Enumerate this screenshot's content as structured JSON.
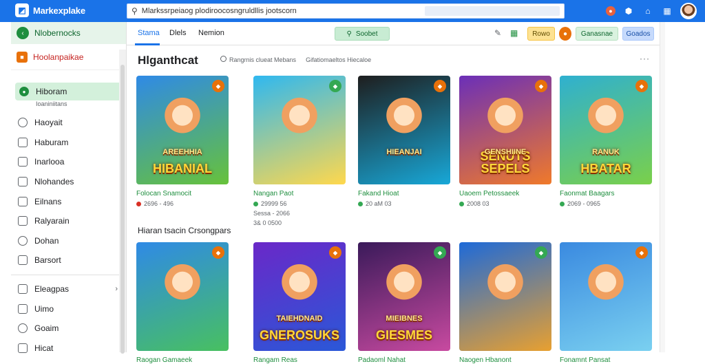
{
  "topbar": {
    "brand_name": "Markexplake",
    "search_value": "Mlarkssrpeiaog plodiroocosngruldllis jootscorn",
    "icons": [
      "notification-icon",
      "shield-icon",
      "home-icon",
      "apps-grid-icon",
      "avatar"
    ]
  },
  "sidebar": {
    "header_label": "Nlobernocks",
    "brand_label": "Hoolanpaikae",
    "active_item": {
      "label": "Hiboram",
      "sub": "Ioaniniitans"
    },
    "items": [
      {
        "label": "Haoyait",
        "icon": "circle-icon"
      },
      {
        "label": "Haburam",
        "icon": "gamepad-icon"
      },
      {
        "label": "Inarlooa",
        "icon": "grid-icon"
      },
      {
        "label": "Nlohandes",
        "icon": "list-icon"
      },
      {
        "label": "Eilnans",
        "icon": "box-icon"
      },
      {
        "label": "Ralyarain",
        "icon": "store-icon"
      },
      {
        "label": "Dohan",
        "icon": "circle-icon"
      },
      {
        "label": "Barsort",
        "icon": "square-icon"
      }
    ],
    "bottom_items": [
      {
        "label": "Eleagpas",
        "icon": "folder-icon"
      },
      {
        "label": "Uimo",
        "icon": "chart-icon"
      },
      {
        "label": "Goaim",
        "icon": "clock-icon"
      },
      {
        "label": "Hicat",
        "icon": "doc-icon"
      }
    ]
  },
  "toolbar": {
    "tabs": [
      "Stama",
      "Dlels",
      "Nemion"
    ],
    "active_tab": "Stama",
    "green_button": "Soobet",
    "yellow_button": "Rowo",
    "light_green_button": "Ganasnae",
    "blue_button": "Goados"
  },
  "content": {
    "heading": "Hlganthcat",
    "meta_one": "Rangrnis clueat Mebans",
    "meta_two": "Gifatiomaeltos Hiecaloe",
    "more": "···",
    "section_title": "Hiaran tsacin Crsongpars"
  },
  "cards_row1": [
    {
      "title": "Folocan Snamocit",
      "meta": "2696 - 496",
      "art": "HIBANIAL",
      "art_sub": "AREEHHIA",
      "badge_color": "#e8710a",
      "meta_dot": "#d93025",
      "bg1": "#2f8ae6",
      "bg2": "#67c23a"
    },
    {
      "title": "Nangan Paot",
      "meta": "29999 56",
      "meta2": "Sessa - 2066",
      "meta2_b": "3& 0 0500",
      "art": "",
      "badge_color": "#34a853",
      "meta_dot": "#34a853",
      "bg1": "#2fb8f0",
      "bg2": "#ffd84d"
    },
    {
      "title": "Fakand Hioat",
      "meta": "20 aM 03",
      "art": "",
      "art_sub": "HIEANJAI",
      "badge_color": "#e8710a",
      "meta_dot": "#34a853",
      "bg1": "#1e1e1e",
      "bg2": "#18a8d8"
    },
    {
      "title": "Uaoem Petossaeek",
      "meta": "2008 03",
      "art": "SENUTS SEPELS",
      "art_sub": "GENSHIINE",
      "badge_color": "#e8710a",
      "meta_dot": "#34a853",
      "bg1": "#6b2fb8",
      "bg2": "#f07a2a"
    },
    {
      "title": "Faonmat Baagars",
      "meta": "2069 - 0965",
      "art": "HBATAR",
      "art_sub": "RANUK",
      "badge_color": "#e8710a",
      "meta_dot": "#34a853",
      "bg1": "#2fb0d0",
      "bg2": "#7ad04a"
    }
  ],
  "cards_row2": [
    {
      "title": "Raogan Gamaeek",
      "art": "",
      "badge_color": "#e8710a",
      "bg1": "#2f8ae6",
      "bg2": "#48c060"
    },
    {
      "title": "Rangam Reas",
      "art": "GNEROSUKS",
      "art_sub": "TAIEHDNAID",
      "badge_color": "#e8710a",
      "bg1": "#6a28c8",
      "bg2": "#2a58d8"
    },
    {
      "title": "Padaoml Nahat",
      "art": "GIESMES",
      "art_sub": "MIEIBNES",
      "badge_color": "#34a853",
      "bg1": "#3a1a5a",
      "bg2": "#c84aa0"
    },
    {
      "title": "Naogen Hbanont",
      "art": "",
      "badge_color": "#34a853",
      "bg1": "#1e6ad8",
      "bg2": "#e8a030"
    },
    {
      "title": "Fonamnt Pansat",
      "art": "",
      "badge_color": "#e8710a",
      "bg1": "#3a8ae0",
      "bg2": "#7ad0f0"
    }
  ],
  "colors": {
    "topbar": "#1a73e8",
    "accent_green": "#1e8e3e",
    "accent_orange": "#e8710a"
  }
}
